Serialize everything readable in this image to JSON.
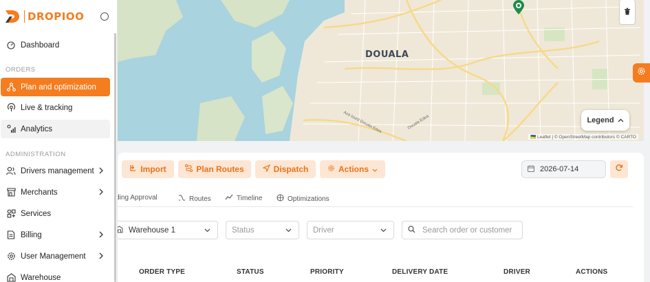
{
  "app": {
    "brand": "DROPIOO",
    "accent": "#f47d20"
  },
  "sidebar": {
    "dashboard": "Dashboard",
    "orders_title": "ORDERS",
    "orders": [
      {
        "label": "Plan and optimization",
        "icon": "route-icon",
        "active": true
      },
      {
        "label": "Live & tracking",
        "icon": "location-signal-icon"
      },
      {
        "label": "Analytics",
        "icon": "analytics-icon"
      }
    ],
    "admin_title": "ADMINISTRATION",
    "admin": [
      {
        "label": "Drivers management",
        "icon": "users-icon"
      },
      {
        "label": "Merchants",
        "icon": "store-icon"
      },
      {
        "label": "Services",
        "icon": "services-icon"
      },
      {
        "label": "Billing",
        "icon": "document-icon"
      },
      {
        "label": "User Management",
        "icon": "gear-icon"
      },
      {
        "label": "Warehouse",
        "icon": "warehouse-icon"
      }
    ]
  },
  "map": {
    "city": "DOUALA",
    "road_1": "Axe lourd Douala Edea",
    "road_2": "Douala Edea",
    "legend_label": "Legend",
    "attribution": "🇺🇦 Leaflet | © OpenStreetMap contributors © CARTO"
  },
  "toolbar": {
    "import": "Import",
    "plan_routes": "Plan Routes",
    "dispatch": "Dispatch",
    "actions": "Actions",
    "date": "2026-07-14"
  },
  "tabs": [
    "ending Approval",
    "Routes",
    "Timeline",
    "Optimizations"
  ],
  "filters": {
    "warehouse": "Warehouse 1",
    "status_placeholder": "Status",
    "driver_placeholder": "Driver",
    "search_placeholder": "Search order or customer"
  },
  "table": {
    "headers": [
      "ORDER TYPE",
      "STATUS",
      "PRIORITY",
      "DELIVERY DATE",
      "DRIVER",
      "ACTIONS"
    ]
  }
}
